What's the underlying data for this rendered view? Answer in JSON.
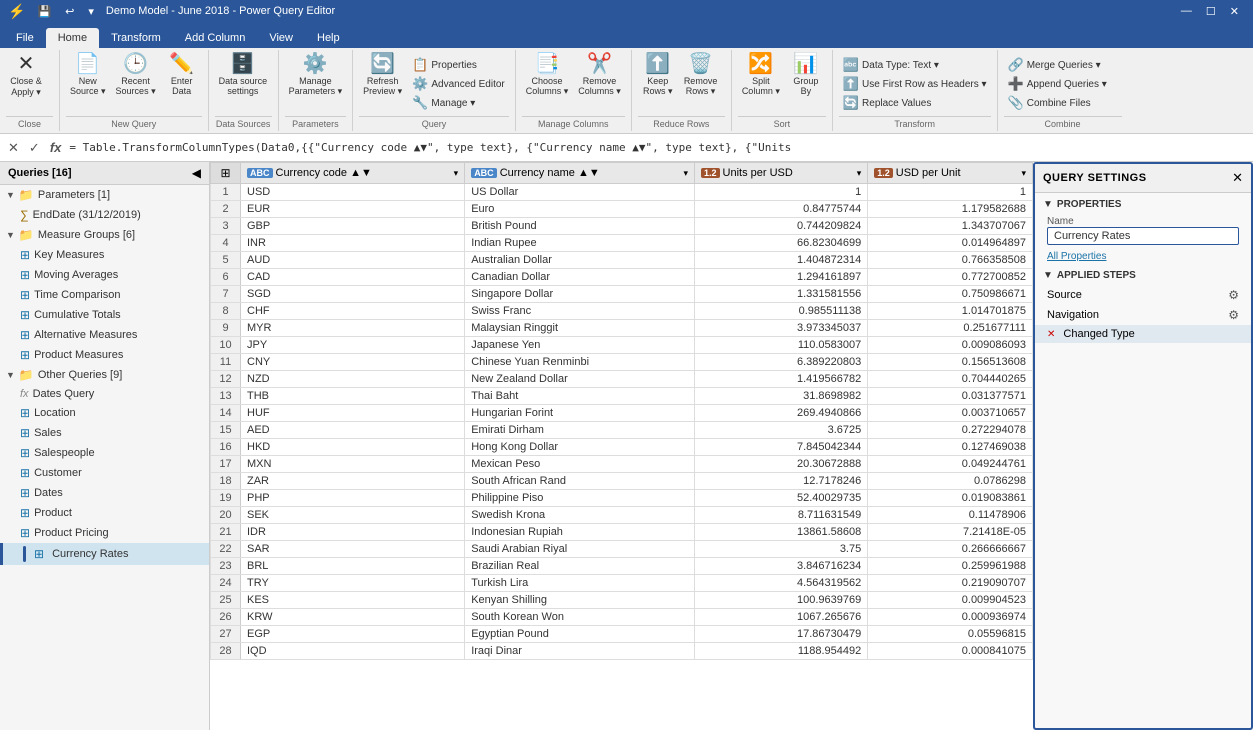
{
  "titleBar": {
    "icon": "⚡",
    "title": "Demo Model - June 2018 - Power Query Editor",
    "controls": [
      "—",
      "☐",
      "✕"
    ]
  },
  "ribbonTabs": [
    "File",
    "Home",
    "Transform",
    "Add Column",
    "View",
    "Help"
  ],
  "activeTab": "Home",
  "ribbon": {
    "groups": [
      {
        "name": "Close",
        "items": [
          {
            "type": "big",
            "icon": "✕",
            "label": "Close &\nApply",
            "dropdown": true
          }
        ]
      },
      {
        "name": "New Query",
        "items": [
          {
            "type": "big",
            "icon": "📄",
            "label": "New\nSource",
            "dropdown": true
          },
          {
            "type": "big",
            "icon": "🕒",
            "label": "Recent\nSources",
            "dropdown": true
          },
          {
            "type": "big",
            "icon": "✏️",
            "label": "Enter\nData"
          }
        ]
      },
      {
        "name": "Data Sources",
        "items": [
          {
            "type": "big",
            "icon": "🗄️",
            "label": "Data source\nsettings"
          }
        ]
      },
      {
        "name": "Parameters",
        "items": [
          {
            "type": "big",
            "icon": "⚙️",
            "label": "Manage\nParameters",
            "dropdown": true
          }
        ]
      },
      {
        "name": "Query",
        "items": [
          {
            "type": "big",
            "icon": "🔄",
            "label": "Refresh\nPreview",
            "dropdown": true
          },
          {
            "type": "big",
            "icon": "📋",
            "label": "Properties"
          },
          {
            "type": "big",
            "icon": "⚙️",
            "label": "Advanced Editor"
          },
          {
            "type": "big",
            "icon": "🔧",
            "label": "Manage",
            "dropdown": true
          }
        ]
      },
      {
        "name": "Manage Columns",
        "items": [
          {
            "type": "big",
            "icon": "📑",
            "label": "Choose\nColumns",
            "dropdown": true
          },
          {
            "type": "big",
            "icon": "✂️",
            "label": "Remove\nColumns",
            "dropdown": true
          }
        ]
      },
      {
        "name": "Reduce Rows",
        "items": [
          {
            "type": "big",
            "icon": "⬆️",
            "label": "Keep\nRows",
            "dropdown": true
          },
          {
            "type": "big",
            "icon": "🗑️",
            "label": "Remove\nRows",
            "dropdown": true
          }
        ]
      },
      {
        "name": "Sort",
        "items": [
          {
            "type": "big",
            "icon": "🔀",
            "label": "Split\nColumn",
            "dropdown": true
          },
          {
            "type": "big",
            "icon": "📊",
            "label": "Group\nBy"
          }
        ]
      },
      {
        "name": "Transform",
        "items_small": [
          {
            "icon": "🔤",
            "label": "Data Type: Text ▾"
          },
          {
            "icon": "⬆️",
            "label": "Use First Row as Headers ▾"
          },
          {
            "icon": "🔄",
            "label": "Replace Values"
          }
        ]
      },
      {
        "name": "Combine",
        "items_small": [
          {
            "icon": "🔗",
            "label": "Merge Queries ▾"
          },
          {
            "icon": "➕",
            "label": "Append Queries ▾"
          },
          {
            "icon": "📎",
            "label": "Combine Files"
          }
        ]
      }
    ]
  },
  "formulaBar": {
    "cancelBtn": "✕",
    "confirmBtn": "✓",
    "fxLabel": "fx",
    "formula": "= Table.TransformColumnTypes(Data0,{{\"Currency code ▲▼\", type text}, {\"Currency name ▲▼\", type text}, {\"Units"
  },
  "sidebar": {
    "title": "Queries [16]",
    "groups": [
      {
        "name": "Parameters [1]",
        "type": "param-group",
        "expanded": true,
        "items": [
          {
            "name": "EndDate (31/12/2019)",
            "type": "param"
          }
        ]
      },
      {
        "name": "Measure Groups [6]",
        "type": "table-group",
        "expanded": true,
        "items": [
          {
            "name": "Key Measures",
            "type": "table"
          },
          {
            "name": "Moving Averages",
            "type": "table"
          },
          {
            "name": "Time Comparison",
            "type": "table"
          },
          {
            "name": "Cumulative Totals",
            "type": "table"
          },
          {
            "name": "Alternative Measures",
            "type": "table"
          },
          {
            "name": "Product Measures",
            "type": "table"
          }
        ]
      },
      {
        "name": "Other Queries [9]",
        "type": "table-group",
        "expanded": true,
        "items": [
          {
            "name": "Dates Query",
            "type": "fx"
          },
          {
            "name": "Location",
            "type": "table"
          },
          {
            "name": "Sales",
            "type": "table"
          },
          {
            "name": "Salespeople",
            "type": "table"
          },
          {
            "name": "Customer",
            "type": "table"
          },
          {
            "name": "Dates",
            "type": "table"
          },
          {
            "name": "Product",
            "type": "table"
          },
          {
            "name": "Product Pricing",
            "type": "table"
          },
          {
            "name": "Currency Rates",
            "type": "table",
            "selected": true,
            "hasIndicator": true
          }
        ]
      }
    ]
  },
  "table": {
    "columns": [
      {
        "label": "Currency code",
        "typeLabel": "ABC",
        "typeClass": "col-type-abc",
        "hasSort": true,
        "hasFilter": true
      },
      {
        "label": "Currency name",
        "typeLabel": "ABC",
        "typeClass": "col-type-abc",
        "hasSort": true,
        "hasFilter": true
      },
      {
        "label": "Units per USD",
        "typeLabel": "1.2",
        "typeClass": "col-type-12",
        "hasSort": false,
        "hasFilter": true
      },
      {
        "label": "USD per Unit",
        "typeLabel": "1.2",
        "typeClass": "col-type-12",
        "hasSort": false,
        "hasFilter": true
      }
    ],
    "rows": [
      {
        "num": 1,
        "c1": "USD",
        "c2": "US Dollar",
        "c3": "1",
        "c4": "1"
      },
      {
        "num": 2,
        "c1": "EUR",
        "c2": "Euro",
        "c3": "0.84775744",
        "c4": "1.179582688"
      },
      {
        "num": 3,
        "c1": "GBP",
        "c2": "British Pound",
        "c3": "0.744209824",
        "c4": "1.343707067"
      },
      {
        "num": 4,
        "c1": "INR",
        "c2": "Indian Rupee",
        "c3": "66.82304699",
        "c4": "0.014964897"
      },
      {
        "num": 5,
        "c1": "AUD",
        "c2": "Australian Dollar",
        "c3": "1.404872314",
        "c4": "0.766358508"
      },
      {
        "num": 6,
        "c1": "CAD",
        "c2": "Canadian Dollar",
        "c3": "1.294161897",
        "c4": "0.772700852"
      },
      {
        "num": 7,
        "c1": "SGD",
        "c2": "Singapore Dollar",
        "c3": "1.331581556",
        "c4": "0.750986671"
      },
      {
        "num": 8,
        "c1": "CHF",
        "c2": "Swiss Franc",
        "c3": "0.985511138",
        "c4": "1.014701875"
      },
      {
        "num": 9,
        "c1": "MYR",
        "c2": "Malaysian Ringgit",
        "c3": "3.973345037",
        "c4": "0.251677111"
      },
      {
        "num": 10,
        "c1": "JPY",
        "c2": "Japanese Yen",
        "c3": "110.0583007",
        "c4": "0.009086093"
      },
      {
        "num": 11,
        "c1": "CNY",
        "c2": "Chinese Yuan Renminbi",
        "c3": "6.389220803",
        "c4": "0.156513608"
      },
      {
        "num": 12,
        "c1": "NZD",
        "c2": "New Zealand Dollar",
        "c3": "1.419566782",
        "c4": "0.704440265"
      },
      {
        "num": 13,
        "c1": "THB",
        "c2": "Thai Baht",
        "c3": "31.8698982",
        "c4": "0.031377571"
      },
      {
        "num": 14,
        "c1": "HUF",
        "c2": "Hungarian Forint",
        "c3": "269.4940866",
        "c4": "0.003710657"
      },
      {
        "num": 15,
        "c1": "AED",
        "c2": "Emirati Dirham",
        "c3": "3.6725",
        "c4": "0.272294078"
      },
      {
        "num": 16,
        "c1": "HKD",
        "c2": "Hong Kong Dollar",
        "c3": "7.845042344",
        "c4": "0.127469038"
      },
      {
        "num": 17,
        "c1": "MXN",
        "c2": "Mexican Peso",
        "c3": "20.30672888",
        "c4": "0.049244761"
      },
      {
        "num": 18,
        "c1": "ZAR",
        "c2": "South African Rand",
        "c3": "12.7178246",
        "c4": "0.0786298"
      },
      {
        "num": 19,
        "c1": "PHP",
        "c2": "Philippine Piso",
        "c3": "52.40029735",
        "c4": "0.019083861"
      },
      {
        "num": 20,
        "c1": "SEK",
        "c2": "Swedish Krona",
        "c3": "8.711631549",
        "c4": "0.11478906"
      },
      {
        "num": 21,
        "c1": "IDR",
        "c2": "Indonesian Rupiah",
        "c3": "13861.58608",
        "c4": "7.21418E-05"
      },
      {
        "num": 22,
        "c1": "SAR",
        "c2": "Saudi Arabian Riyal",
        "c3": "3.75",
        "c4": "0.266666667"
      },
      {
        "num": 23,
        "c1": "BRL",
        "c2": "Brazilian Real",
        "c3": "3.846716234",
        "c4": "0.259961988"
      },
      {
        "num": 24,
        "c1": "TRY",
        "c2": "Turkish Lira",
        "c3": "4.564319562",
        "c4": "0.219090707"
      },
      {
        "num": 25,
        "c1": "KES",
        "c2": "Kenyan Shilling",
        "c3": "100.9639769",
        "c4": "0.009904523"
      },
      {
        "num": 26,
        "c1": "KRW",
        "c2": "South Korean Won",
        "c3": "1067.265676",
        "c4": "0.000936974"
      },
      {
        "num": 27,
        "c1": "EGP",
        "c2": "Egyptian Pound",
        "c3": "17.86730479",
        "c4": "0.05596815"
      },
      {
        "num": 28,
        "c1": "IQD",
        "c2": "Iraqi Dinar",
        "c3": "1188.954492",
        "c4": "0.000841075"
      }
    ]
  },
  "querySettings": {
    "title": "QUERY SETTINGS",
    "properties": {
      "header": "PROPERTIES",
      "nameLabel": "Name",
      "nameValue": "Currency Rates",
      "allPropertiesLink": "All Properties"
    },
    "appliedSteps": {
      "header": "APPLIED STEPS",
      "steps": [
        {
          "name": "Source",
          "hasGear": true
        },
        {
          "name": "Navigation",
          "hasGear": true
        },
        {
          "name": "Changed Type",
          "hasDelete": true
        }
      ]
    }
  }
}
